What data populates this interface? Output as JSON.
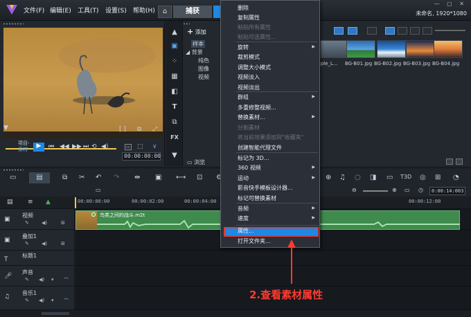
{
  "menubar": {
    "items": [
      "文件(F)",
      "编辑(E)",
      "工具(T)",
      "设置(S)",
      "帮助(H)"
    ],
    "capture_tab": "捕获",
    "project_info": "未命名, 1920*1080"
  },
  "preview": {
    "project_label": "项目-",
    "clip_label": "素材-",
    "timecode": "00:00:00:00"
  },
  "library": {
    "add_label": "添加",
    "tree": [
      "样本",
      "背景",
      "纯色",
      "图像",
      "视频"
    ],
    "browse_label": "浏览",
    "thumbnails": [
      "mple_L...",
      "BG-B01.jpg",
      "BG-B02.jpg",
      "BG-B03.jpg",
      "BG-B04.jpg"
    ]
  },
  "timeline": {
    "timecode": "0:00:14:003",
    "ruler": [
      "00:00:00:00",
      "00:00:02:00",
      "00:00:04:00",
      "00:00:12:00"
    ],
    "tracks": [
      {
        "name": "视频",
        "icon": "video-icon"
      },
      {
        "name": "叠加1",
        "icon": "overlay-icon"
      },
      {
        "name": "标题1",
        "icon": "title-icon"
      },
      {
        "name": "声音",
        "icon": "voice-icon"
      },
      {
        "name": "音乐1",
        "icon": "music-icon"
      }
    ],
    "clip_title": "鸟类之间的战斗.m2t"
  },
  "context_menu": {
    "items": [
      {
        "label": "删除",
        "enabled": true,
        "submenu": false
      },
      {
        "label": "复制属性",
        "enabled": true,
        "submenu": false
      },
      {
        "label": "粘贴所有属性",
        "enabled": false,
        "submenu": false
      },
      {
        "label": "粘贴可选属性...",
        "enabled": false,
        "submenu": false
      },
      {
        "label": "旋转",
        "enabled": true,
        "submenu": true
      },
      {
        "label": "裁剪模式",
        "enabled": true,
        "submenu": false
      },
      {
        "label": "调整大小模式",
        "enabled": true,
        "submenu": false
      },
      {
        "label": "视频淡入",
        "enabled": true,
        "submenu": false
      },
      {
        "label": "视频淡出",
        "enabled": true,
        "submenu": false
      },
      {
        "label": "群组",
        "enabled": true,
        "submenu": true
      },
      {
        "label": "多重修整视频...",
        "enabled": true,
        "submenu": false
      },
      {
        "label": "替换素材...",
        "enabled": true,
        "submenu": true
      },
      {
        "label": "分割素材",
        "enabled": false,
        "submenu": false
      },
      {
        "label": "将当前效果添加到\"收藏夹\"",
        "enabled": false,
        "submenu": false
      },
      {
        "label": "创建智能代理文件",
        "enabled": true,
        "submenu": false
      },
      {
        "label": "标记为 3D...",
        "enabled": true,
        "submenu": false
      },
      {
        "label": "360 视频",
        "enabled": true,
        "submenu": true
      },
      {
        "label": "运动",
        "enabled": true,
        "submenu": true
      },
      {
        "label": "影音快手模板设计器...",
        "enabled": true,
        "submenu": false
      },
      {
        "label": "标记可替换素材",
        "enabled": true,
        "submenu": false
      },
      {
        "label": "音频",
        "enabled": true,
        "submenu": true
      },
      {
        "label": "速度",
        "enabled": true,
        "submenu": true
      },
      {
        "label": "属性...",
        "enabled": true,
        "submenu": false
      },
      {
        "label": "打开文件夹...",
        "enabled": true,
        "submenu": false
      }
    ]
  },
  "annotation": {
    "text": "2.查看素材属性",
    "color": "#ff3b2f"
  }
}
